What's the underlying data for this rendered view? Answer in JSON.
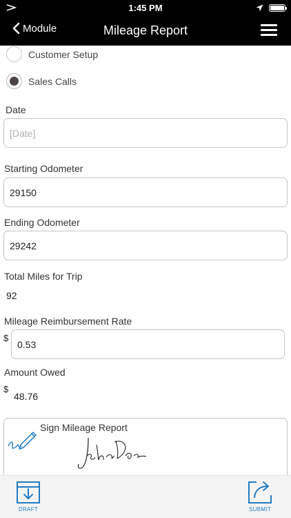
{
  "status_bar": {
    "time": "1:45 PM"
  },
  "nav": {
    "back_label": "Module",
    "title": "Mileage Report"
  },
  "options": [
    {
      "label": "Customer Setup",
      "selected": false
    },
    {
      "label": "Sales Calls",
      "selected": true
    }
  ],
  "fields": {
    "date": {
      "label": "Date",
      "placeholder": "[Date]"
    },
    "starting_odometer": {
      "label": "Starting Odometer",
      "value": "29150"
    },
    "ending_odometer": {
      "label": "Ending Odometer",
      "value": "29242"
    },
    "total_miles": {
      "label": "Total Miles for Trip",
      "value": "92"
    },
    "reimbursement_rate": {
      "label": "Mileage Reimbursement Rate",
      "currency": "$",
      "value": "0.53"
    },
    "amount_owed": {
      "label": "Amount Owed",
      "currency": "$",
      "value": "48.76"
    }
  },
  "signature": {
    "label": "Sign Mileage Report"
  },
  "toolbar": {
    "draft_label": "DRAFT",
    "submit_label": "SUBMIT"
  },
  "colors": {
    "accent": "#1e7bc3",
    "nav_background": "#000000"
  }
}
